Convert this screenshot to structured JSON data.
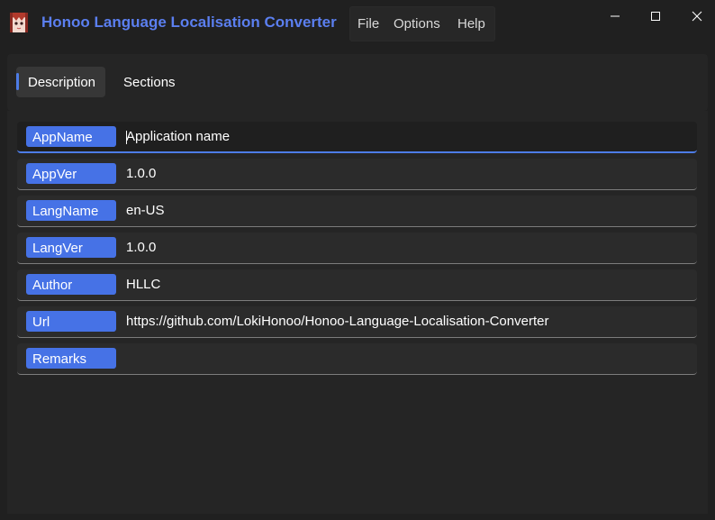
{
  "window": {
    "title": "Honoo Language Localisation Converter",
    "menu": [
      {
        "label": "File"
      },
      {
        "label": "Options"
      },
      {
        "label": "Help"
      }
    ],
    "accent": "#5b7ff0",
    "icons": {
      "app": "anime-character-icon",
      "minimize": "minimize-icon",
      "maximize": "maximize-icon",
      "close": "close-icon"
    }
  },
  "tabs": [
    {
      "label": "Description",
      "selected": true
    },
    {
      "label": "Sections",
      "selected": false
    }
  ],
  "fields": [
    {
      "key": "AppName",
      "value": "Application name",
      "focused": true
    },
    {
      "key": "AppVer",
      "value": "1.0.0"
    },
    {
      "key": "LangName",
      "value": "en-US"
    },
    {
      "key": "LangVer",
      "value": "1.0.0"
    },
    {
      "key": "Author",
      "value": "HLLC"
    },
    {
      "key": "Url",
      "value": "https://github.com/LokiHonoo/Honoo-Language-Localisation-Converter"
    },
    {
      "key": "Remarks",
      "value": ""
    }
  ],
  "colors": {
    "tag": "#4672e6",
    "focus_underline": "#4d7ce6",
    "background": "#202020"
  }
}
